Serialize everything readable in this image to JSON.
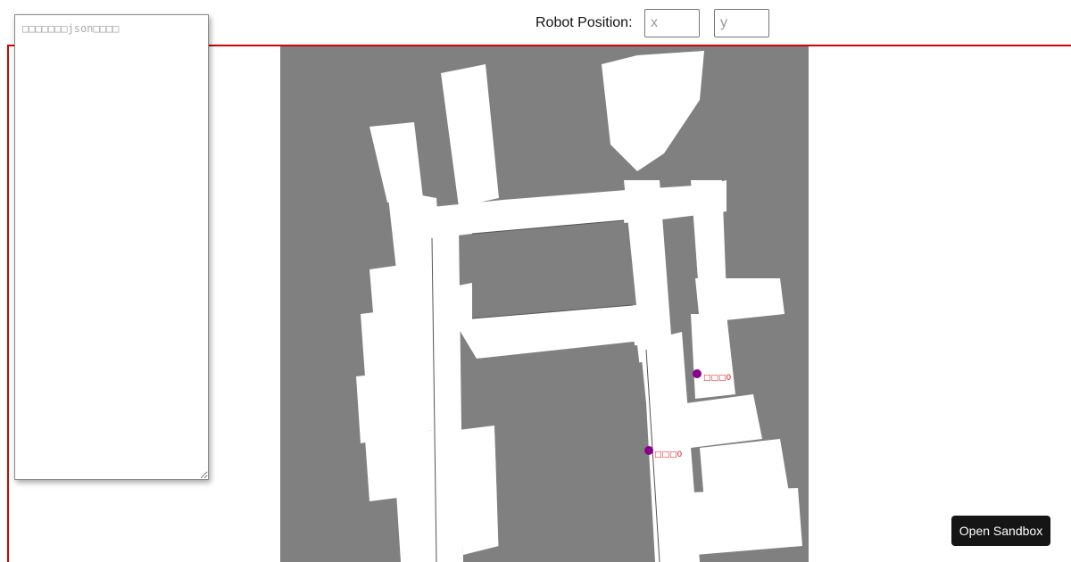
{
  "header": {
    "robot_position_label": "Robot Position:",
    "x_placeholder": "x",
    "y_placeholder": "y"
  },
  "json_editor": {
    "placeholder": "□□□□□□□json□□□□"
  },
  "map": {
    "free_color": "#ffffff",
    "unknown_color": "#808080",
    "marker_color": "#8b008b",
    "markers": [
      {
        "label": "□□□0"
      },
      {
        "label": "□□□0"
      }
    ]
  },
  "sandbox": {
    "label": "Open Sandbox"
  },
  "colors": {
    "frame_border": "#d40000",
    "button_bg": "#151515"
  }
}
